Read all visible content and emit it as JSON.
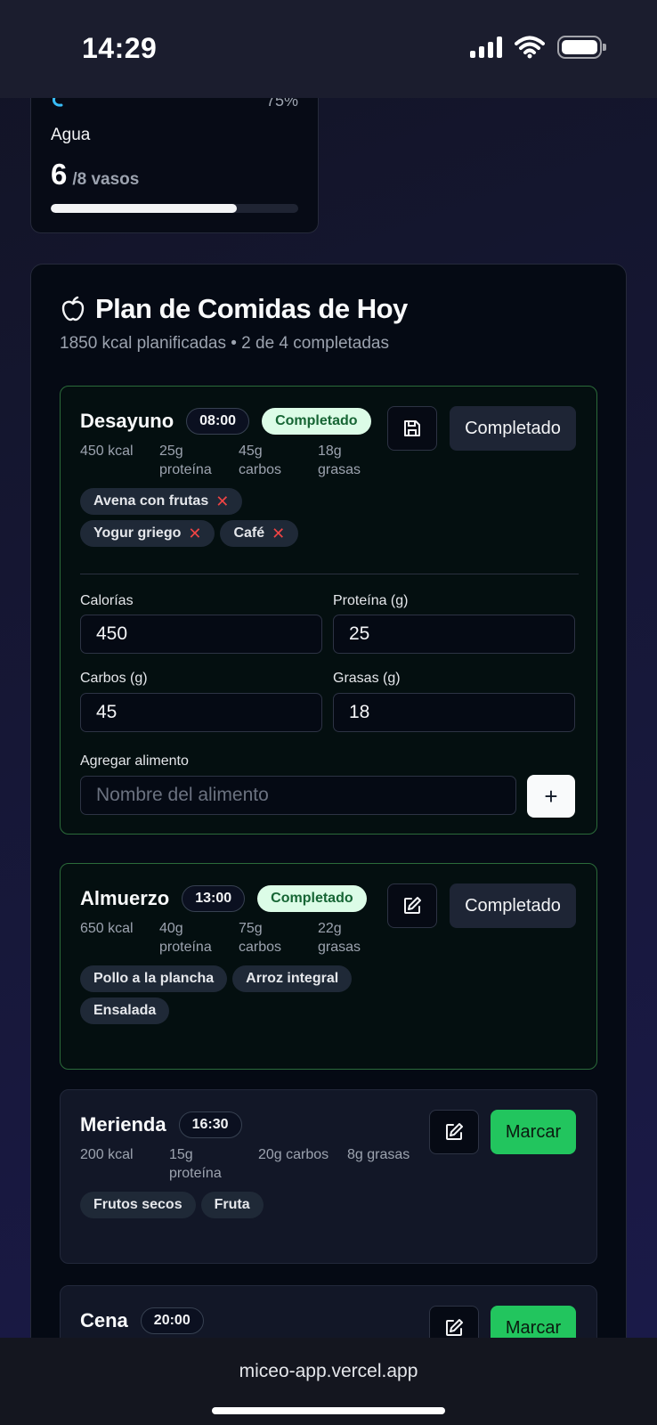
{
  "status_bar": {
    "time": "14:29"
  },
  "water": {
    "percent": "75%",
    "label": "Agua",
    "value": "6",
    "unit": "/8 vasos",
    "progress": 0.75
  },
  "plan": {
    "title": "Plan de Comidas de Hoy",
    "subtitle": "1850 kcal planificadas • 2 de 4 completadas",
    "meals": [
      {
        "name": "Desayuno",
        "time": "08:00",
        "status_pill": "Completado",
        "kcal": "450 kcal",
        "protein": [
          "25g",
          "proteína"
        ],
        "carbs": [
          "45g",
          "carbos"
        ],
        "fat": [
          "18g",
          "grasas"
        ],
        "foods": [
          "Avena con frutas",
          "Yogur griego",
          "Café"
        ],
        "action": "Completado",
        "form": {
          "calories_label": "Calorías",
          "calories": "450",
          "protein_label": "Proteína (g)",
          "protein": "25",
          "carbs_label": "Carbos (g)",
          "carbs": "45",
          "fat_label": "Grasas (g)",
          "fat": "18",
          "add_label": "Agregar alimento",
          "add_placeholder": "Nombre del alimento"
        }
      },
      {
        "name": "Almuerzo",
        "time": "13:00",
        "status_pill": "Completado",
        "kcal": "650 kcal",
        "protein": [
          "40g",
          "proteína"
        ],
        "carbs": [
          "75g",
          "carbos"
        ],
        "fat": [
          "22g",
          "grasas"
        ],
        "foods": [
          "Pollo a la plancha",
          "Arroz integral",
          "Ensalada"
        ],
        "action": "Completado"
      },
      {
        "name": "Merienda",
        "time": "16:30",
        "kcal": "200 kcal",
        "protein": [
          "15g",
          "proteína"
        ],
        "carbs": "20g carbos",
        "fat": "8g grasas",
        "foods": [
          "Frutos secos",
          "Fruta"
        ],
        "action": "Marcar"
      },
      {
        "name": "Cena",
        "time": "20:00",
        "action": "Marcar"
      }
    ]
  },
  "browser": {
    "url": "miceo-app.vercel.app"
  }
}
